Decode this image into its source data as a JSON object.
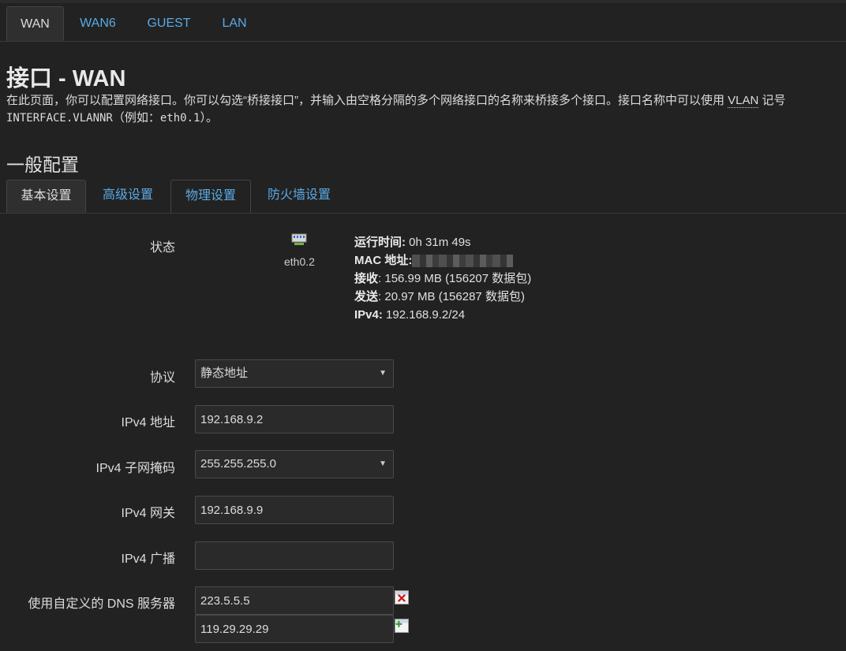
{
  "top_tabs": [
    "WAN",
    "WAN6",
    "GUEST",
    "LAN"
  ],
  "page": {
    "title": "接口 - WAN",
    "desc_part1": "在此页面，你可以配置网络接口。你可以勾选“桥接接口”，并输入由空格分隔的多个网络接口的名称来桥接多个接口。接口名称中可以使用 ",
    "desc_abbr": "VLAN",
    "desc_part2": " 记号",
    "desc_mono": "INTERFACE.VLANNR",
    "desc_part3": "（例如：",
    "desc_mono2": "eth0.1",
    "desc_part4": "）。"
  },
  "section_title": "一般配置",
  "sub_tabs": [
    "基本设置",
    "高级设置",
    "物理设置",
    "防火墙设置"
  ],
  "status": {
    "label": "状态",
    "ifname": "eth0.2",
    "uptime_label": "运行时间:",
    "uptime": " 0h 31m 49s",
    "mac_label": "MAC 地址:",
    "rx_label": "接收",
    "rx": ": 156.99 MB (156207 数据包)",
    "tx_label": "发送",
    "tx": ": 20.97 MB (156287 数据包)",
    "ipv4_label": "IPv4:",
    "ipv4": " 192.168.9.2/24"
  },
  "form": {
    "protocol_label": "协议",
    "protocol_value": "静态地址",
    "ipv4_addr_label": "IPv4 地址",
    "ipv4_addr_value": "192.168.9.2",
    "netmask_label": "IPv4 子网掩码",
    "netmask_value": "255.255.255.0",
    "gateway_label": "IPv4 网关",
    "gateway_value": "192.168.9.9",
    "broadcast_label": "IPv4 广播",
    "broadcast_value": "",
    "dns_label": "使用自定义的 DNS 服务器",
    "dns_values": [
      "223.5.5.5",
      "119.29.29.29"
    ]
  },
  "icons": {
    "dropdown": "chevron-down-icon",
    "remove": "remove-icon",
    "add": "add-icon",
    "network": "ethernet-port-icon"
  },
  "colors": {
    "background": "#222222",
    "link": "#5aa9e6",
    "text": "#e0e0e0"
  }
}
